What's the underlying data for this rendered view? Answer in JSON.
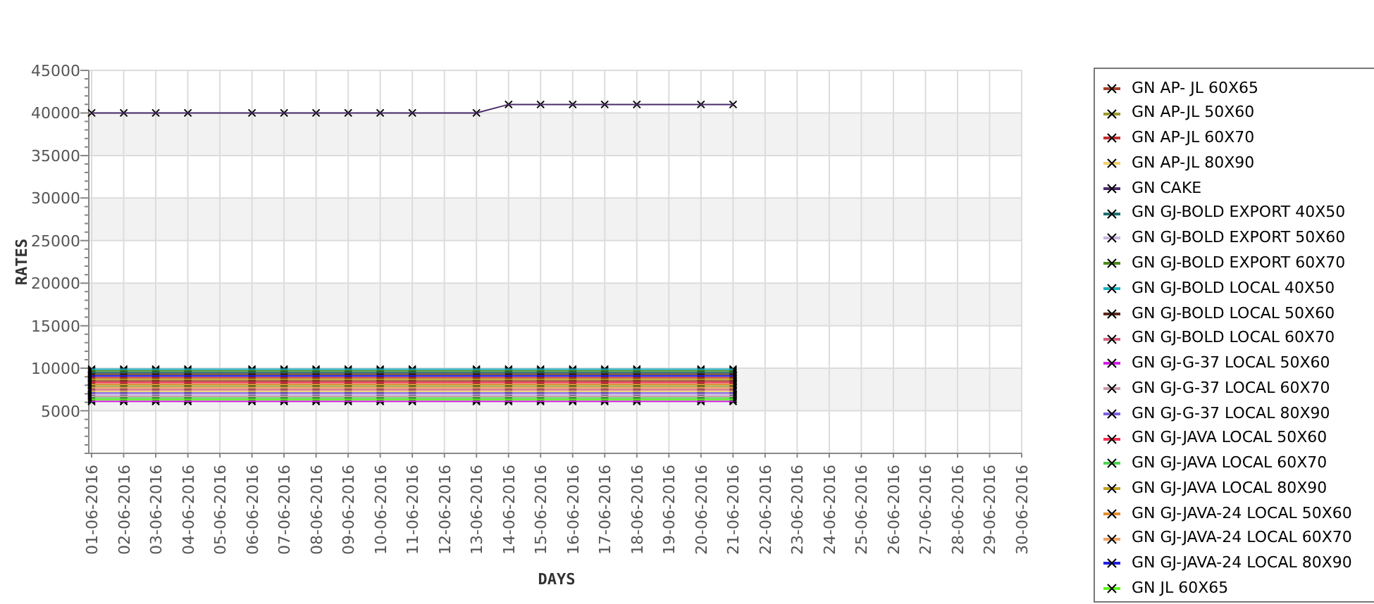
{
  "chart_data": {
    "type": "line",
    "grid": true,
    "xlabel": "DAYS",
    "ylabel": "RATES",
    "categories": [
      "01-06-2016",
      "02-06-2016",
      "03-06-2016",
      "04-06-2016",
      "05-06-2016",
      "06-06-2016",
      "07-06-2016",
      "08-06-2016",
      "09-06-2016",
      "10-06-2016",
      "11-06-2016",
      "12-06-2016",
      "13-06-2016",
      "14-06-2016",
      "15-06-2016",
      "16-06-2016",
      "17-06-2016",
      "18-06-2016",
      "19-06-2016",
      "20-06-2016",
      "21-06-2016",
      "22-06-2016",
      "23-06-2016",
      "24-06-2016",
      "25-06-2016",
      "26-06-2016",
      "27-06-2016",
      "28-06-2016",
      "29-06-2016",
      "30-06-2016"
    ],
    "ylim": [
      0,
      45000
    ],
    "yticks": [
      5000,
      10000,
      15000,
      20000,
      25000,
      30000,
      35000,
      40000,
      45000
    ],
    "series": [
      {
        "name": "GN AP- JL 60X65",
        "color": "#a0402a",
        "marker": "x",
        "values": [
          8500,
          8500,
          8500,
          8500,
          null,
          8500,
          8500,
          8500,
          8500,
          8500,
          8500,
          null,
          8500,
          8500,
          8500,
          8500,
          8500,
          8500,
          null,
          8500,
          8500,
          null,
          null,
          null,
          null,
          null,
          null,
          null,
          null,
          null
        ]
      },
      {
        "name": "GN AP-JL 50X60",
        "color": "#999933",
        "marker": "x",
        "values": [
          7900,
          7900,
          7900,
          7900,
          null,
          7900,
          7900,
          7900,
          7900,
          7900,
          7900,
          null,
          7900,
          7900,
          7900,
          7900,
          7900,
          7900,
          null,
          7900,
          7900,
          null,
          null,
          null,
          null,
          null,
          null,
          null,
          null,
          null
        ]
      },
      {
        "name": "GN AP-JL 60X70",
        "color": "#c03030",
        "marker": "x",
        "values": [
          8900,
          8900,
          8900,
          8900,
          null,
          8900,
          8900,
          8900,
          8900,
          8900,
          8900,
          null,
          8900,
          8900,
          8900,
          8900,
          8900,
          8900,
          null,
          8900,
          8900,
          null,
          null,
          null,
          null,
          null,
          null,
          null,
          null,
          null
        ]
      },
      {
        "name": "GN AP-JL 80X90",
        "color": "#f0d070",
        "marker": "x",
        "values": [
          7300,
          7300,
          7300,
          7300,
          null,
          7300,
          7300,
          7300,
          7300,
          7300,
          7300,
          null,
          7300,
          7300,
          7300,
          7300,
          7300,
          7300,
          null,
          7300,
          7300,
          null,
          null,
          null,
          null,
          null,
          null,
          null,
          null,
          null
        ]
      },
      {
        "name": "GN CAKE",
        "color": "#4b2a6a",
        "marker": "x",
        "values": [
          40000,
          40000,
          40000,
          40000,
          null,
          40000,
          40000,
          40000,
          40000,
          40000,
          40000,
          null,
          40000,
          41000,
          41000,
          41000,
          41000,
          41000,
          null,
          41000,
          41000,
          null,
          null,
          null,
          null,
          null,
          null,
          null,
          null,
          null
        ]
      },
      {
        "name": "GN GJ-BOLD EXPORT 40X50",
        "color": "#1f6f6f",
        "marker": "x",
        "values": [
          9500,
          9500,
          9500,
          9500,
          null,
          9500,
          9500,
          9500,
          9500,
          9500,
          9500,
          null,
          9500,
          9500,
          9500,
          9500,
          9500,
          9500,
          null,
          9500,
          9500,
          null,
          null,
          null,
          null,
          null,
          null,
          null,
          null,
          null
        ]
      },
      {
        "name": "GN GJ-BOLD EXPORT 50X60",
        "color": "#c8b4e0",
        "marker": "x",
        "values": [
          6900,
          6900,
          6900,
          6900,
          null,
          6900,
          6900,
          6900,
          6900,
          6900,
          6900,
          null,
          6900,
          6900,
          6900,
          6900,
          6900,
          6900,
          null,
          6900,
          6900,
          null,
          null,
          null,
          null,
          null,
          null,
          null,
          null,
          null
        ]
      },
      {
        "name": "GN GJ-BOLD EXPORT 60X70",
        "color": "#4a8a1a",
        "marker": "x",
        "values": [
          9700,
          9700,
          9700,
          9700,
          null,
          9700,
          9700,
          9700,
          9700,
          9700,
          9700,
          null,
          9700,
          9700,
          9700,
          9700,
          9700,
          9700,
          null,
          9700,
          9700,
          null,
          null,
          null,
          null,
          null,
          null,
          null,
          null,
          null
        ]
      },
      {
        "name": "GN GJ-BOLD LOCAL 40X50",
        "color": "#20b0c0",
        "marker": "x",
        "values": [
          9900,
          9900,
          9900,
          9900,
          null,
          9900,
          9900,
          9900,
          9900,
          9900,
          9900,
          null,
          9900,
          9900,
          9900,
          9900,
          9900,
          9900,
          null,
          9900,
          9900,
          null,
          null,
          null,
          null,
          null,
          null,
          null,
          null,
          null
        ]
      },
      {
        "name": "GN GJ-BOLD LOCAL 50X60",
        "color": "#5a2a1a",
        "marker": "x",
        "values": [
          9300,
          9300,
          9300,
          9300,
          null,
          9300,
          9300,
          9300,
          9300,
          9300,
          9300,
          null,
          9300,
          9300,
          9300,
          9300,
          9300,
          9300,
          null,
          9300,
          9300,
          null,
          null,
          null,
          null,
          null,
          null,
          null,
          null,
          null
        ]
      },
      {
        "name": "GN GJ-BOLD LOCAL 60X70",
        "color": "#d06080",
        "marker": "x",
        "values": [
          7500,
          7500,
          7500,
          7500,
          null,
          7500,
          7500,
          7500,
          7500,
          7500,
          7500,
          null,
          7500,
          7500,
          7500,
          7500,
          7500,
          7500,
          null,
          7500,
          7500,
          null,
          null,
          null,
          null,
          null,
          null,
          null,
          null,
          null
        ]
      },
      {
        "name": "GN GJ-G-37 LOCAL 50X60",
        "color": "#d020e0",
        "marker": "x",
        "values": [
          6100,
          6100,
          6100,
          6100,
          null,
          6100,
          6100,
          6100,
          6100,
          6100,
          6100,
          null,
          6100,
          6100,
          6100,
          6100,
          6100,
          6100,
          null,
          6100,
          6100,
          null,
          null,
          null,
          null,
          null,
          null,
          null,
          null,
          null
        ]
      },
      {
        "name": "GN GJ-G-37 LOCAL 60X70",
        "color": "#c89aa8",
        "marker": "x",
        "values": [
          6700,
          6700,
          6700,
          6700,
          null,
          6700,
          6700,
          6700,
          6700,
          6700,
          6700,
          null,
          6700,
          6700,
          6700,
          6700,
          6700,
          6700,
          null,
          6700,
          6700,
          null,
          null,
          null,
          null,
          null,
          null,
          null,
          null,
          null
        ]
      },
      {
        "name": "GN GJ-G-37 LOCAL 80X90",
        "color": "#8060e0",
        "marker": "x",
        "values": [
          7100,
          7100,
          7100,
          7100,
          null,
          7100,
          7100,
          7100,
          7100,
          7100,
          7100,
          null,
          7100,
          7100,
          7100,
          7100,
          7100,
          7100,
          null,
          7100,
          7100,
          null,
          null,
          null,
          null,
          null,
          null,
          null,
          null,
          null
        ]
      },
      {
        "name": "GN GJ-JAVA LOCAL 50X60",
        "color": "#f03050",
        "marker": "x",
        "values": [
          8300,
          8300,
          8300,
          8300,
          null,
          8300,
          8300,
          8300,
          8300,
          8300,
          8300,
          null,
          8300,
          8300,
          8300,
          8300,
          8300,
          8300,
          null,
          8300,
          8300,
          null,
          null,
          null,
          null,
          null,
          null,
          null,
          null,
          null
        ]
      },
      {
        "name": "GN GJ-JAVA LOCAL 60X70",
        "color": "#50d050",
        "marker": "x",
        "values": [
          6500,
          6500,
          6500,
          6500,
          null,
          6500,
          6500,
          6500,
          6500,
          6500,
          6500,
          null,
          6500,
          6500,
          6500,
          6500,
          6500,
          6500,
          null,
          6500,
          6500,
          null,
          null,
          null,
          null,
          null,
          null,
          null,
          null,
          null
        ]
      },
      {
        "name": "GN GJ-JAVA LOCAL 80X90",
        "color": "#c0a020",
        "marker": "x",
        "values": [
          8700,
          8700,
          8700,
          8700,
          null,
          8700,
          8700,
          8700,
          8700,
          8700,
          8700,
          null,
          8700,
          8700,
          8700,
          8700,
          8700,
          8700,
          null,
          8700,
          8700,
          null,
          null,
          null,
          null,
          null,
          null,
          null,
          null,
          null
        ]
      },
      {
        "name": "GN GJ-JAVA-24 LOCAL 50X60",
        "color": "#e09030",
        "marker": "x",
        "values": [
          8100,
          8100,
          8100,
          8100,
          null,
          8100,
          8100,
          8100,
          8100,
          8100,
          8100,
          null,
          8100,
          8100,
          8100,
          8100,
          8100,
          8100,
          null,
          8100,
          8100,
          null,
          null,
          null,
          null,
          null,
          null,
          null,
          null,
          null
        ]
      },
      {
        "name": "GN GJ-JAVA-24 LOCAL 60X70",
        "color": "#f0a060",
        "marker": "x",
        "values": [
          7700,
          7700,
          7700,
          7700,
          null,
          7700,
          7700,
          7700,
          7700,
          7700,
          7700,
          null,
          7700,
          7700,
          7700,
          7700,
          7700,
          7700,
          null,
          7700,
          7700,
          null,
          null,
          null,
          null,
          null,
          null,
          null,
          null,
          null
        ]
      },
      {
        "name": "GN GJ-JAVA-24 LOCAL 80X90",
        "color": "#2020e0",
        "marker": "x",
        "values": [
          9100,
          9100,
          9100,
          9100,
          null,
          9100,
          9100,
          9100,
          9100,
          9100,
          9100,
          null,
          9100,
          9100,
          9100,
          9100,
          9100,
          9100,
          null,
          9100,
          9100,
          null,
          null,
          null,
          null,
          null,
          null,
          null,
          null,
          null
        ]
      },
      {
        "name": "GN JL 60X65",
        "color": "#60f020",
        "marker": "x",
        "values": [
          6300,
          6300,
          6300,
          6300,
          null,
          6300,
          6300,
          6300,
          6300,
          6300,
          6300,
          null,
          6300,
          6300,
          6300,
          6300,
          6300,
          6300,
          null,
          6300,
          6300,
          null,
          null,
          null,
          null,
          null,
          null,
          null,
          null,
          null
        ]
      }
    ]
  }
}
